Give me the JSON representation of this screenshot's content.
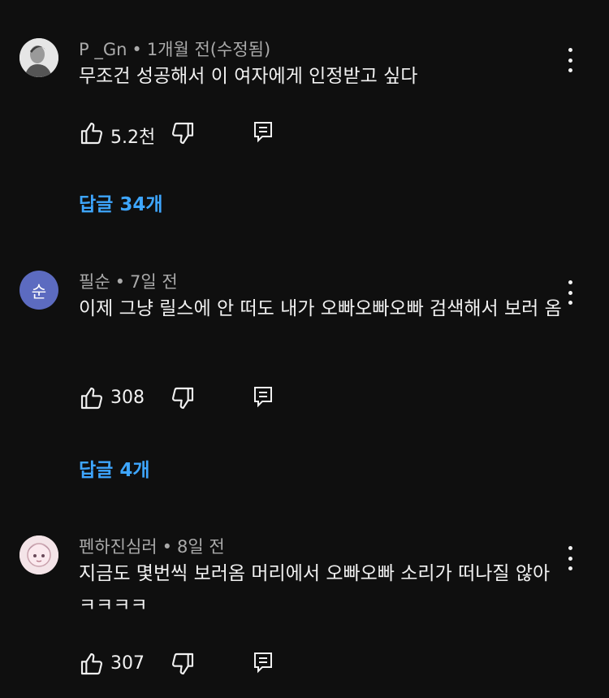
{
  "comments": [
    {
      "author": "P _Gn",
      "time": "1개월 전(수정됨)",
      "text": "무조건 성공해서 이 여자에게 인정받고 싶다",
      "likes": "5.2천",
      "replies": "답글 34개"
    },
    {
      "author": "필순",
      "time": "7일 전",
      "avatar_letter": "순",
      "text": "이제 그냥 릴스에 안 떠도 내가 오빠오빠오빠 검색해서 보러 옴",
      "likes": "308",
      "replies": "답글 4개"
    },
    {
      "author": "펜하진심러",
      "time": "8일 전",
      "text": "지금도 몇번씩 보러옴 머리에서 오빠오빠 소리가 떠나질 않아 ㅋㅋㅋㅋ",
      "likes": "307"
    }
  ],
  "separator": "•",
  "colors": {
    "background": "#0f0f0f",
    "text": "#f1f1f1",
    "meta": "#aaaaaa",
    "link": "#3ea6ff",
    "avatar_2": "#5c6bc0"
  },
  "icons": [
    "thumbs-up-icon",
    "thumbs-down-icon",
    "reply-icon",
    "more-vert-icon"
  ]
}
